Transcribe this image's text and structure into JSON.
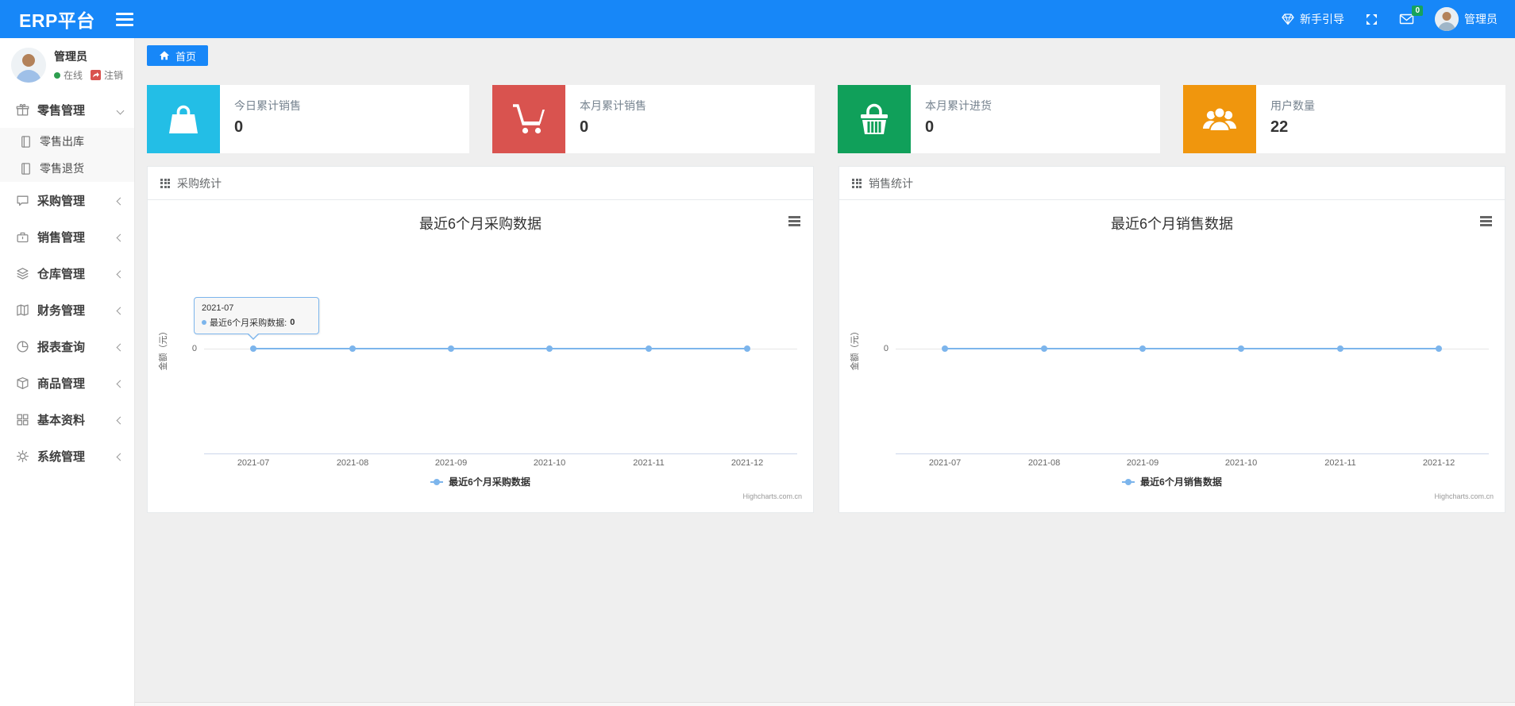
{
  "navbar": {
    "brand": "ERP平台",
    "guide_label": "新手引导",
    "mail_badge": "0",
    "user_name": "管理员"
  },
  "sidebar": {
    "user": {
      "name": "管理员",
      "status": "在线",
      "logout": "注销"
    },
    "items": [
      {
        "label": "零售管理",
        "icon": "gift-icon",
        "state": "expanded",
        "children": [
          {
            "label": "零售出库"
          },
          {
            "label": "零售退货"
          }
        ]
      },
      {
        "label": "采购管理",
        "icon": "chat-icon"
      },
      {
        "label": "销售管理",
        "icon": "briefcase-icon"
      },
      {
        "label": "仓库管理",
        "icon": "layers-icon"
      },
      {
        "label": "财务管理",
        "icon": "book-icon"
      },
      {
        "label": "报表查询",
        "icon": "pie-icon"
      },
      {
        "label": "商品管理",
        "icon": "box-icon"
      },
      {
        "label": "基本资料",
        "icon": "grid-icon"
      },
      {
        "label": "系统管理",
        "icon": "gear-icon"
      }
    ]
  },
  "tabs": {
    "home": "首页"
  },
  "stat_cards": [
    {
      "title": "今日累计销售",
      "value": "0",
      "color": "#23bee6",
      "icon": "bag-icon"
    },
    {
      "title": "本月累计销售",
      "value": "0",
      "color": "#d9534f",
      "icon": "cart-icon"
    },
    {
      "title": "本月累计进货",
      "value": "0",
      "color": "#10a05a",
      "icon": "basket-icon"
    },
    {
      "title": "用户数量",
      "value": "22",
      "color": "#f0960d",
      "icon": "users-icon"
    }
  ],
  "chart_data": [
    {
      "type": "line",
      "panel_title": "采购统计",
      "title": "最近6个月采购数据",
      "x": [
        "2021-07",
        "2021-08",
        "2021-09",
        "2021-10",
        "2021-11",
        "2021-12"
      ],
      "series": [
        {
          "name": "最近6个月采购数据",
          "values": [
            0,
            0,
            0,
            0,
            0,
            0
          ],
          "color": "#7cb5ec"
        }
      ],
      "ylabel": "金额（元）",
      "ytick": "0",
      "ylim": [
        0,
        0
      ],
      "grid": "on",
      "legend_position": "bottom",
      "credit": "Highcharts.com.cn",
      "tooltip": {
        "visible": true,
        "header": "2021-07",
        "series_label": "最近6个月采购数据:",
        "value": "0"
      }
    },
    {
      "type": "line",
      "panel_title": "销售统计",
      "title": "最近6个月销售数据",
      "x": [
        "2021-07",
        "2021-08",
        "2021-09",
        "2021-10",
        "2021-11",
        "2021-12"
      ],
      "series": [
        {
          "name": "最近6个月销售数据",
          "values": [
            0,
            0,
            0,
            0,
            0,
            0
          ],
          "color": "#7cb5ec"
        }
      ],
      "ylabel": "金额（元）",
      "ytick": "0",
      "ylim": [
        0,
        0
      ],
      "grid": "on",
      "legend_position": "bottom",
      "credit": "Highcharts.com.cn",
      "tooltip": {
        "visible": false
      }
    }
  ]
}
